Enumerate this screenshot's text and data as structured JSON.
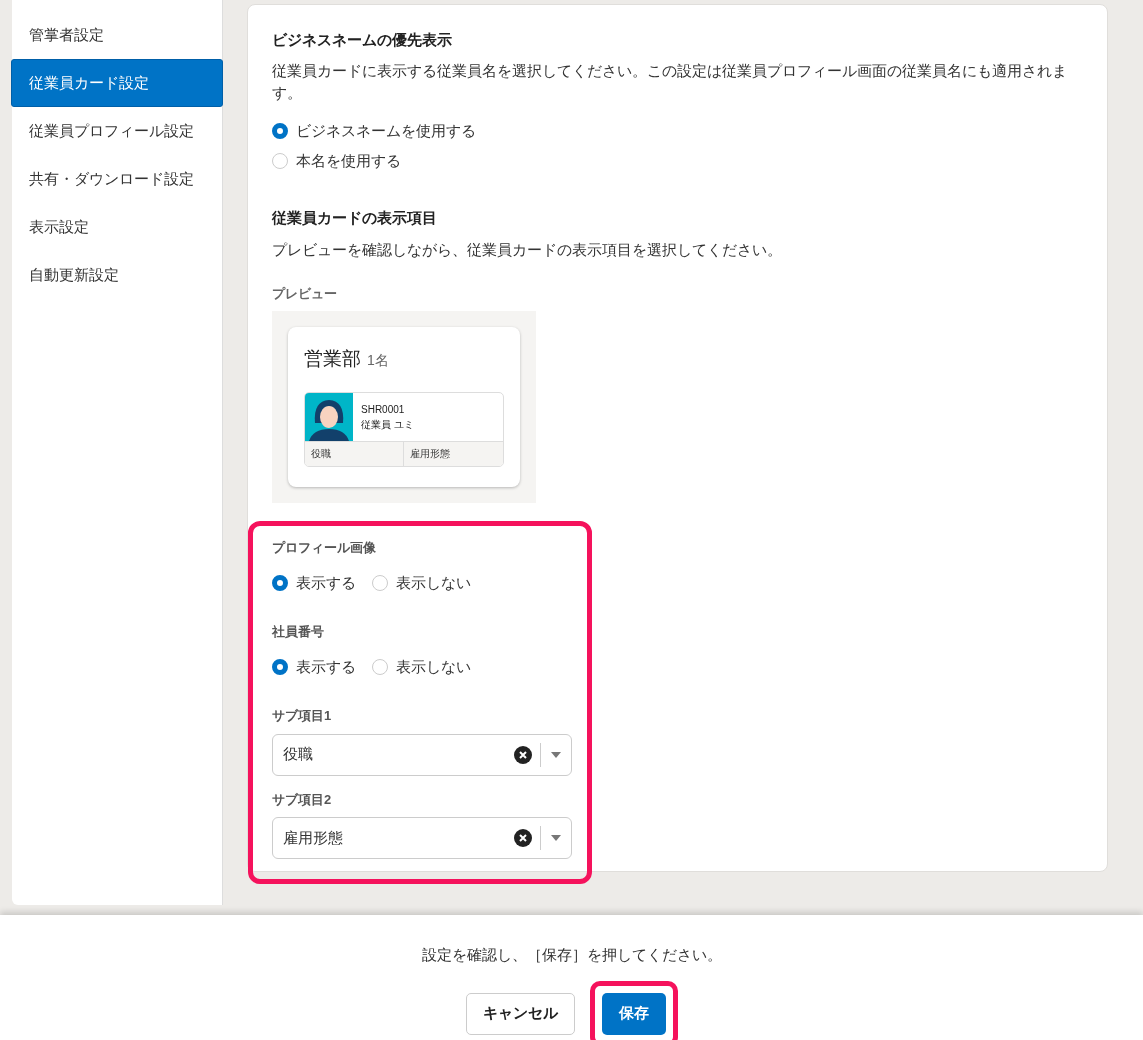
{
  "sidebar": {
    "items": [
      {
        "label": "管掌者設定",
        "selected": false
      },
      {
        "label": "従業員カード設定",
        "selected": true
      },
      {
        "label": "従業員プロフィール設定",
        "selected": false
      },
      {
        "label": "共有・ダウンロード設定",
        "selected": false
      },
      {
        "label": "表示設定",
        "selected": false
      },
      {
        "label": "自動更新設定",
        "selected": false
      }
    ]
  },
  "name_section": {
    "title": "ビジネスネームの優先表示",
    "description": "従業員カードに表示する従業員名を選択してください。この設定は従業員プロフィール画面の従業員名にも適用されます。",
    "options": [
      {
        "label": "ビジネスネームを使用する",
        "selected": true
      },
      {
        "label": "本名を使用する",
        "selected": false
      }
    ]
  },
  "items_section": {
    "title": "従業員カードの表示項目",
    "description": "プレビューを確認しながら、従業員カードの表示項目を選択してください。",
    "preview_label": "プレビュー",
    "preview": {
      "department": "営業部",
      "count": "1名",
      "employee_id": "SHR0001",
      "employee_name": "従業員 ユミ",
      "sub_item_1": "役職",
      "sub_item_2": "雇用形態"
    },
    "fields": [
      {
        "kind": "radio",
        "label": "プロフィール画像",
        "options": [
          {
            "label": "表示する",
            "selected": true
          },
          {
            "label": "表示しない",
            "selected": false
          }
        ]
      },
      {
        "kind": "radio",
        "label": "社員番号",
        "options": [
          {
            "label": "表示する",
            "selected": true
          },
          {
            "label": "表示しない",
            "selected": false
          }
        ]
      },
      {
        "kind": "select",
        "label": "サブ項目1",
        "value": "役職"
      },
      {
        "kind": "select",
        "label": "サブ項目2",
        "value": "雇用形態"
      }
    ]
  },
  "footer": {
    "message": "設定を確認し、［保存］を押してください。",
    "buttons": [
      {
        "kind": "secondary",
        "label": "キャンセル"
      },
      {
        "kind": "primary",
        "label": "保存"
      }
    ]
  }
}
